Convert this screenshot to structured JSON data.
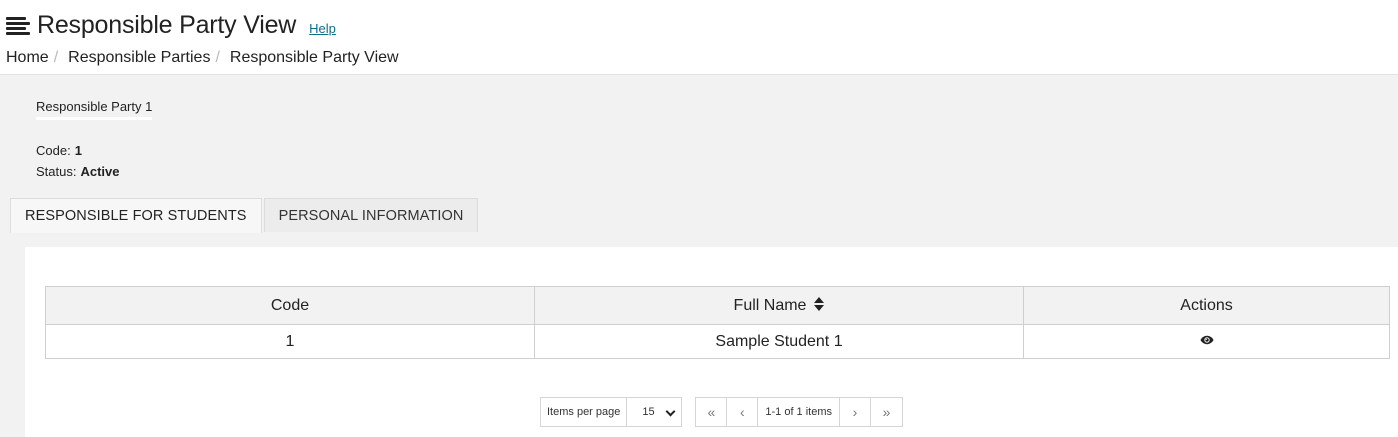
{
  "header": {
    "title": "Responsible Party View",
    "help_label": "Help"
  },
  "breadcrumb": {
    "items": [
      "Home",
      "Responsible Parties"
    ],
    "current": "Responsible Party View",
    "separator": "/"
  },
  "party": {
    "name": "Responsible Party 1",
    "code_label": "Code:",
    "code_value": "1",
    "status_label": "Status:",
    "status_value": "Active"
  },
  "tabs": [
    {
      "label": "RESPONSIBLE FOR STUDENTS",
      "active": true
    },
    {
      "label": "PERSONAL INFORMATION",
      "active": false
    }
  ],
  "table": {
    "columns": [
      "Code",
      "Full Name",
      "Actions"
    ],
    "rows": [
      {
        "code": "1",
        "full_name": "Sample Student 1",
        "action_icon": "eye-icon"
      }
    ]
  },
  "pager": {
    "items_per_page_label": "Items per page",
    "items_per_page_value": "15",
    "info": "1-1 of 1 items",
    "first_icon": "«",
    "prev_icon": "‹",
    "next_icon": "›",
    "last_icon": "»"
  }
}
